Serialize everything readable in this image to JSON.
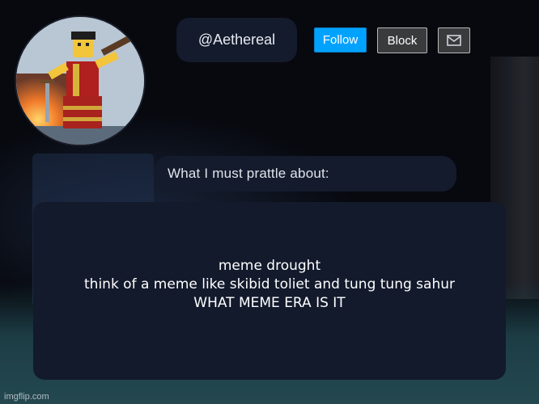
{
  "profile": {
    "username": "@Aethereal",
    "avatar_icon": "roblox-character-avatar"
  },
  "actions": {
    "follow_label": "Follow",
    "block_label": "Block",
    "message_icon": "envelope-icon"
  },
  "section": {
    "prompt": "What I must prattle about:"
  },
  "post": {
    "lines": [
      "meme drought",
      "think of a meme like skibid toliet and tung tung sahur",
      "WHAT MEME ERA IS IT"
    ]
  },
  "watermark": "imgflip.com",
  "colors": {
    "follow": "#00a2ff",
    "pill_bg": "#141b2c",
    "button_gray": "#393b3d"
  }
}
